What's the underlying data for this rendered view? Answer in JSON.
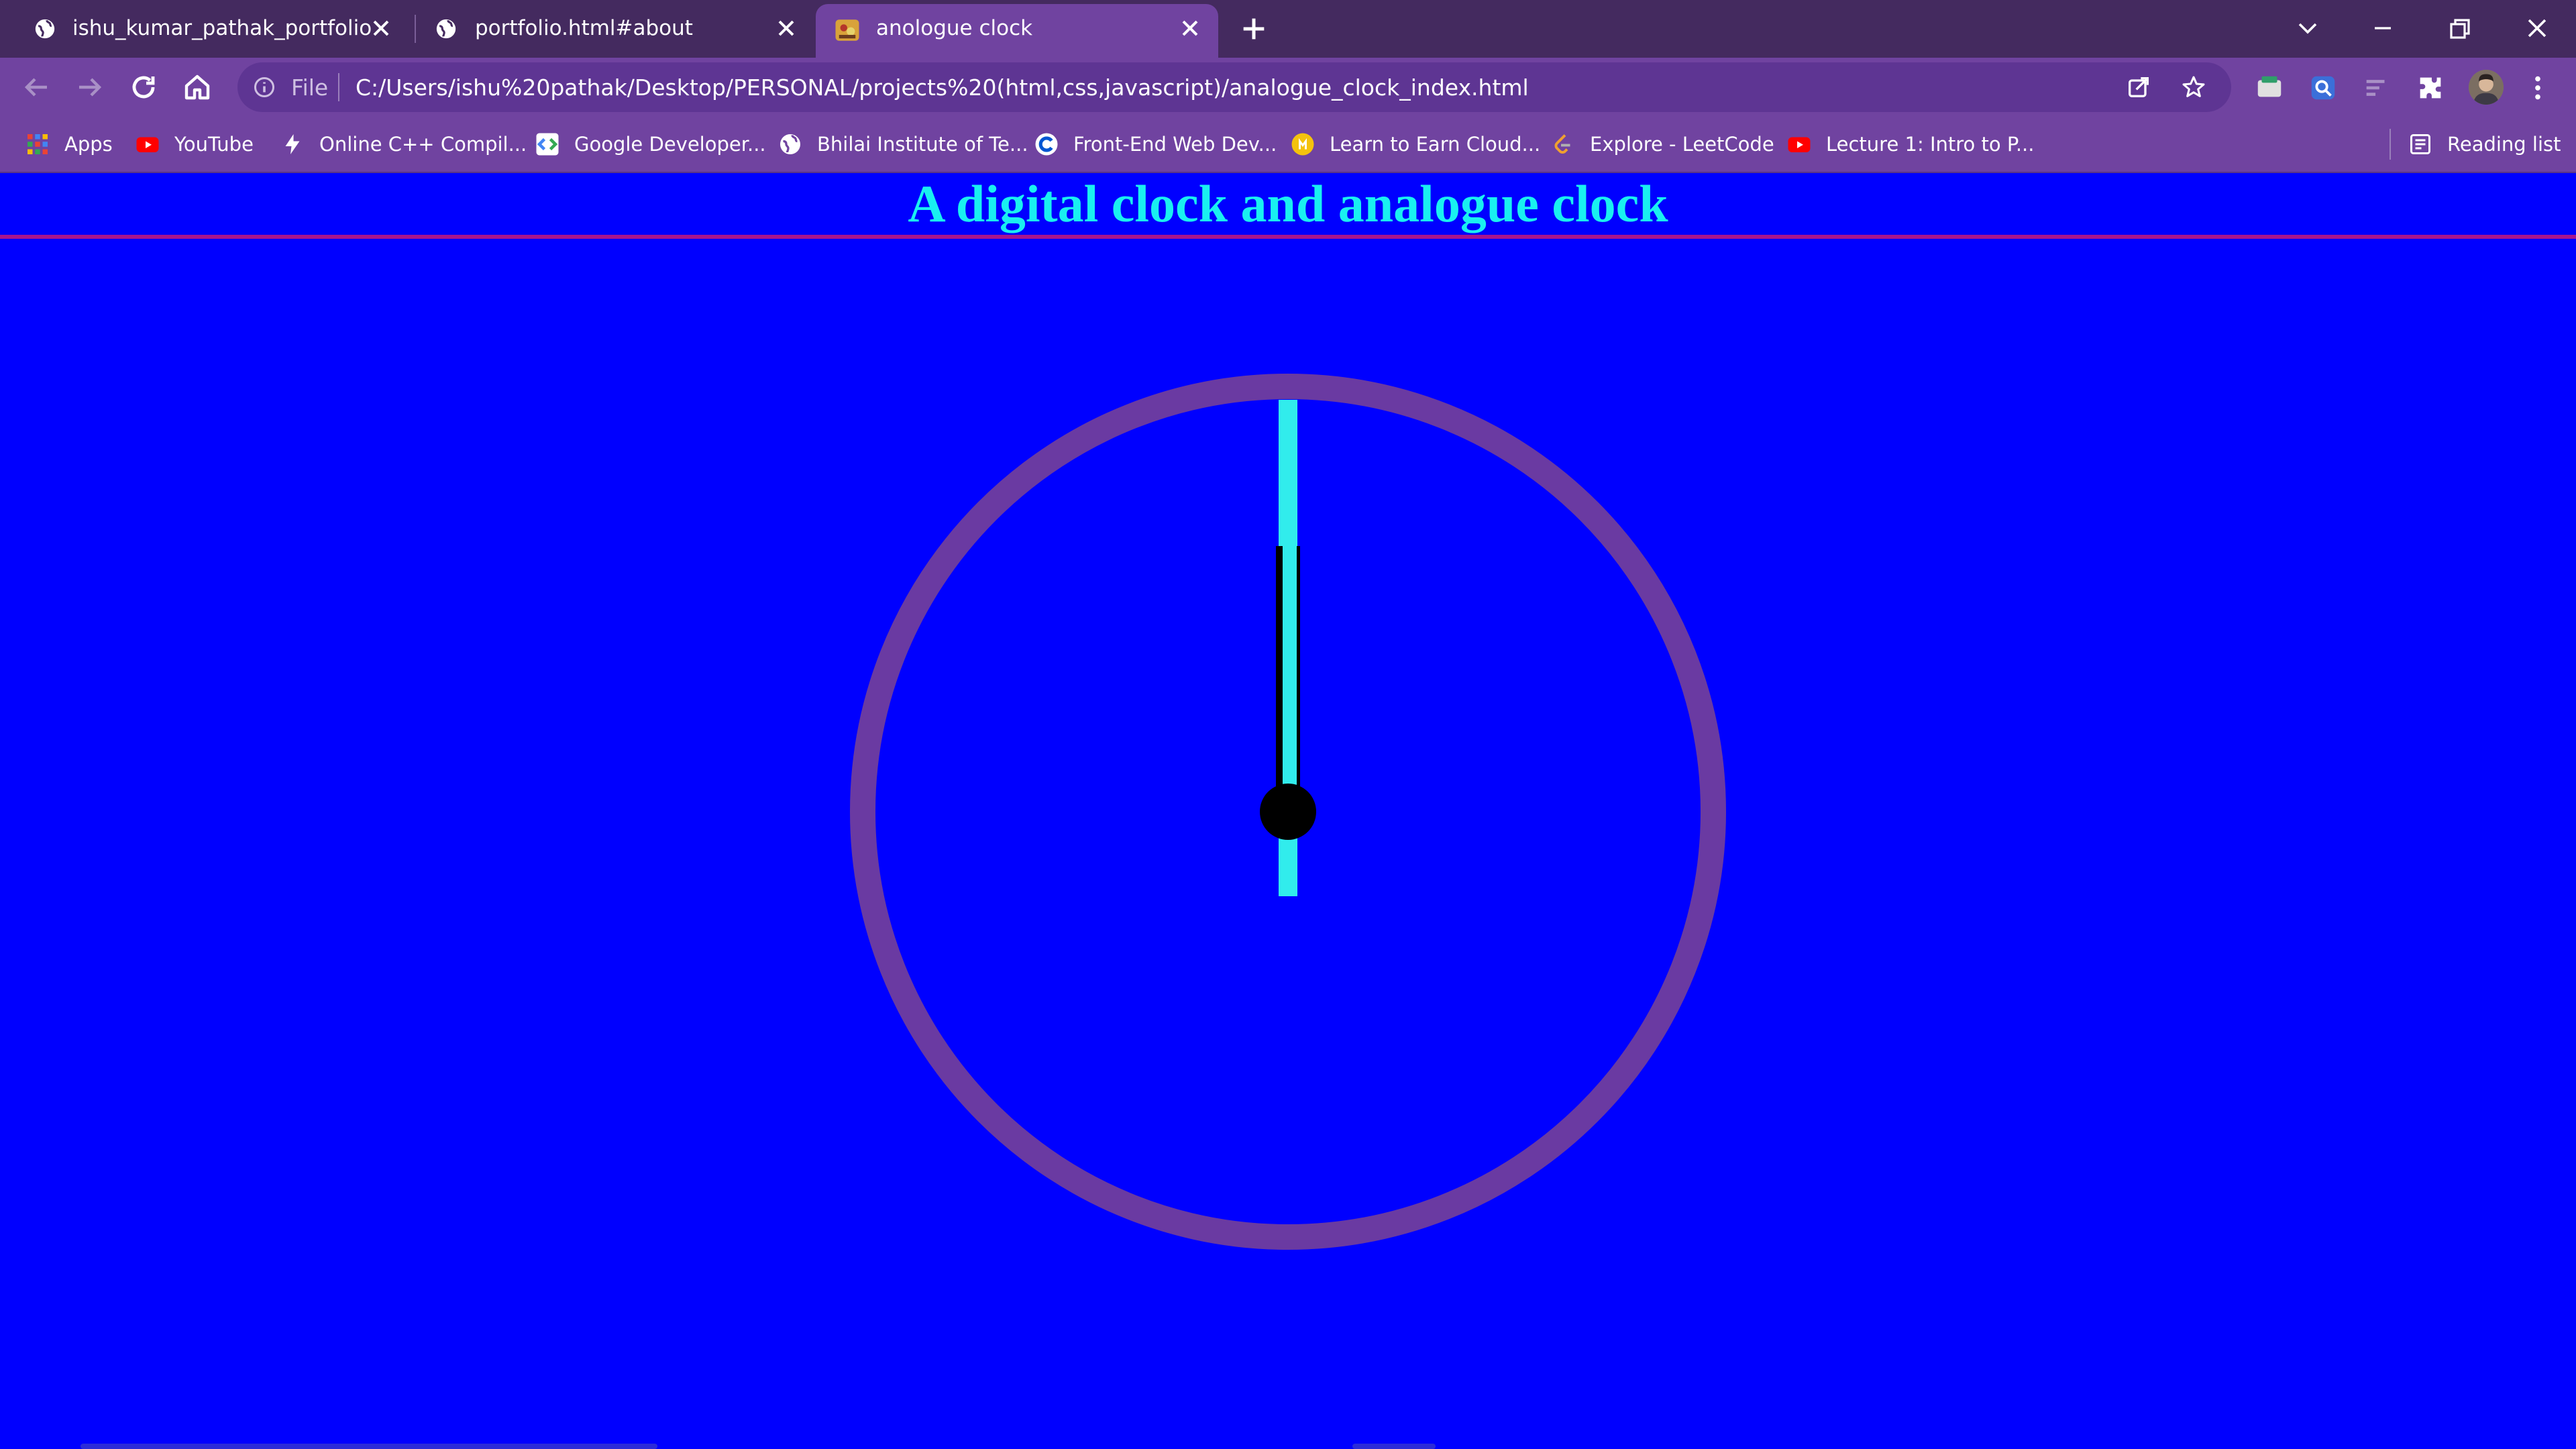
{
  "browser": {
    "tabs": [
      {
        "title": "ishu_kumar_pathak_portfolio",
        "icon": "globe-icon",
        "active": false
      },
      {
        "title": "portfolio.html#about",
        "icon": "globe-icon",
        "active": false
      },
      {
        "title": "anologue clock",
        "icon": "custom-favicon-icon",
        "active": true
      }
    ],
    "omnibox": {
      "scheme_label": "File",
      "url": "C:/Users/ishu%20pathak/Desktop/PERSONAL/projects%20(html,css,javascript)/analogue_clock_index.html"
    },
    "bookmarks": [
      {
        "label": "Apps",
        "icon": "apps-grid-icon"
      },
      {
        "label": "YouTube",
        "icon": "youtube-icon"
      },
      {
        "label": "Online C++ Compil...",
        "icon": "bolt-icon"
      },
      {
        "label": "Google Developer...",
        "icon": "google-developers-icon"
      },
      {
        "label": "Bhilai Institute of Te...",
        "icon": "globe-icon"
      },
      {
        "label": "Front-End Web Dev...",
        "icon": "coursera-icon"
      },
      {
        "label": "Learn to Earn Cloud...",
        "icon": "coin-icon"
      },
      {
        "label": "Explore - LeetCode",
        "icon": "leetcode-icon"
      },
      {
        "label": "Lecture 1: Intro to P...",
        "icon": "youtube-icon"
      }
    ],
    "reading_list_label": "Reading list"
  },
  "page": {
    "heading": "A digital clock and analogue clock"
  },
  "clock": {
    "hour_hand_angle_deg": 0,
    "minute_hand_angle_deg": 0,
    "second_hand_angle_deg": 0
  },
  "colors": {
    "page_background": "#0000ff",
    "heading_text": "#19f0f0",
    "heading_rule": "#a8148f",
    "clock_ring": "#6a3aa2",
    "second_hand": "#31ecec",
    "minute_hand": "#14cfa6",
    "center_dot": "#000000",
    "browser_frame": "#7043a0",
    "tab_strip": "#442a5f"
  }
}
